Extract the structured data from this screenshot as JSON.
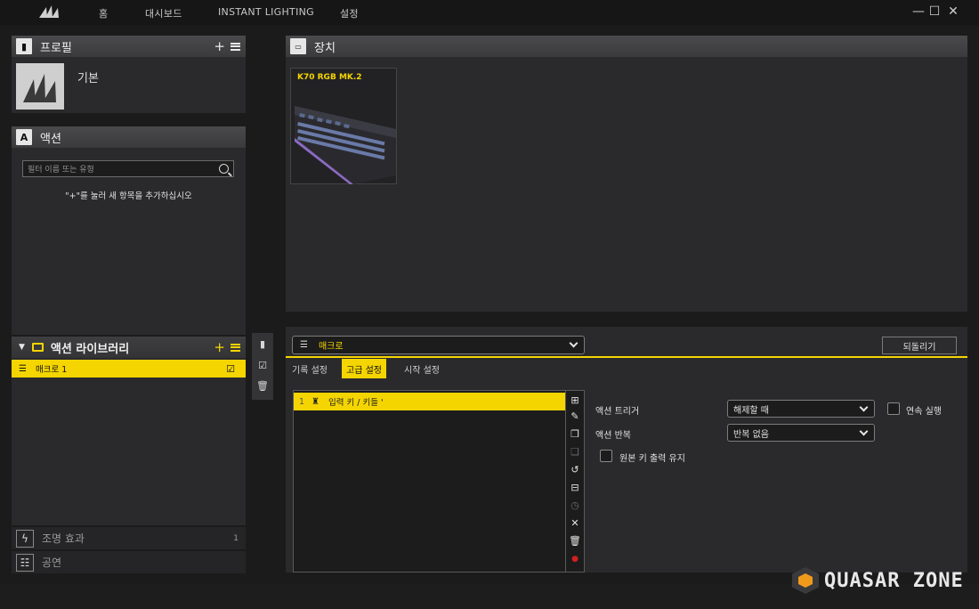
{
  "nav": {
    "home": "홈",
    "dashboard": "대시보드",
    "instant_lighting": "INSTANT LIGHTING",
    "settings": "설정"
  },
  "window_controls": {
    "minimize": "—",
    "maximize": "☐",
    "close": "✕"
  },
  "profile": {
    "header": "프로필",
    "add": "+",
    "name": "기본"
  },
  "actions": {
    "header": "액션",
    "icon_letter": "A",
    "search_placeholder": "필터 이름 또는 유형",
    "hint": "\"+\"를 눌러 새 항목을 추가하십시오"
  },
  "library": {
    "header": "액션 라이브러리",
    "add": "+",
    "items": [
      {
        "label": "매크로 1"
      }
    ]
  },
  "bottom_rows": {
    "lighting": {
      "label": "조명 효과",
      "count": "1"
    },
    "performance": {
      "label": "공연"
    }
  },
  "devices": {
    "header": "장치",
    "cards": [
      {
        "name": "K70 RGB MK.2"
      }
    ]
  },
  "editor": {
    "type_selected": "매크로",
    "revert": "되돌리기",
    "tabs": [
      "기록 설정",
      "고급 설정",
      "시작 설정"
    ],
    "active_tab": "고급 설정",
    "steps": [
      {
        "index": "1",
        "label": "입력 키 / 키들 '"
      }
    ],
    "trigger_label": "액션 트리거",
    "trigger_value": "해제할 때",
    "repeat_label": "액션 반복",
    "repeat_value": "반복 없음",
    "continuous_label": "연속 실행",
    "keep_original_label": "원본 키 출력 유지"
  },
  "watermark": "QUASAR ZONE",
  "colors": {
    "accent": "#f5d500",
    "bg": "#1b1b1c",
    "panel": "#2a2a2c"
  }
}
